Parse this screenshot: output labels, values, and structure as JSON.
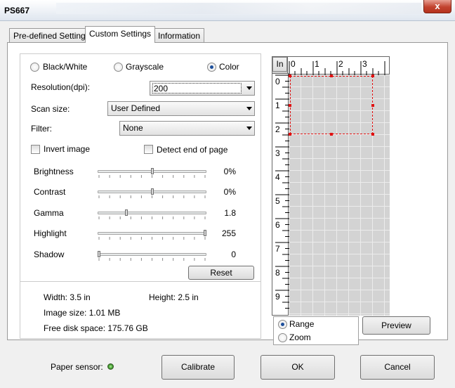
{
  "window": {
    "title": "PS667",
    "close_label": "x"
  },
  "tabs": [
    {
      "label": "Pre-defined Setting"
    },
    {
      "label": "Custom Settings"
    },
    {
      "label": "Information"
    }
  ],
  "color_mode": {
    "options": [
      "Black/White",
      "Grayscale",
      "Color"
    ],
    "selected": "Color"
  },
  "resolution": {
    "label": "Resolution(dpi):",
    "value": "200"
  },
  "scan_size": {
    "label": "Scan size:",
    "value": "User Defined"
  },
  "filter": {
    "label": "Filter:",
    "value": "None"
  },
  "invert_image": {
    "label": "Invert image",
    "checked": false
  },
  "detect_end": {
    "label": "Detect end of page",
    "checked": false
  },
  "sliders": [
    {
      "label": "Brightness",
      "value": "0%",
      "level": 0.5
    },
    {
      "label": "Contrast",
      "value": "0%",
      "level": 0.5
    },
    {
      "label": "Gamma",
      "value": "1.8",
      "level": 0.26
    },
    {
      "label": "Highlight",
      "value": "255",
      "level": 1.0
    },
    {
      "label": "Shadow",
      "value": "0",
      "level": 0.0
    }
  ],
  "reset_label": "Reset",
  "info": {
    "width": "Width: 3.5 in",
    "height": "Height: 2.5 in",
    "image_size": "Image size: 1.01 MB",
    "free_disk": "Free disk space: 175.76 GB"
  },
  "preview": {
    "unit_button": "In",
    "ruler_top": [
      "0",
      "1",
      "2",
      "3"
    ],
    "ruler_left": [
      "0",
      "1",
      "2",
      "3",
      "4",
      "5",
      "6",
      "7",
      "8",
      "9"
    ],
    "selection_color": "#e01010"
  },
  "view_mode": {
    "options": [
      "Range",
      "Zoom"
    ],
    "selected": "Range"
  },
  "preview_button": "Preview",
  "paper_sensor": {
    "label": "Paper sensor:",
    "status_color": "#2e8a1a"
  },
  "buttons": {
    "calibrate": "Calibrate",
    "ok": "OK",
    "cancel": "Cancel"
  }
}
